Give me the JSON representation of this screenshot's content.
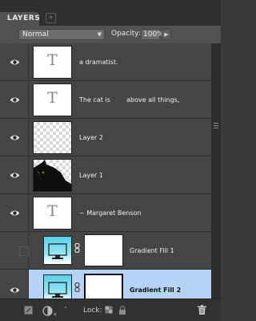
{
  "panel": {
    "tab_title": "LAYERS",
    "tab_menu_icon": "panel-menu-icon"
  },
  "controls": {
    "blend_mode": "Normal",
    "opacity_label": "Opacity:",
    "opacity_value": "100%"
  },
  "layers": [
    {
      "name": "a dramatist.",
      "thumb": "text",
      "thumb_glyph": "T",
      "visible": true,
      "selected": false
    },
    {
      "name": "The cat is        above all things,",
      "thumb": "text",
      "thumb_glyph": "T",
      "visible": true,
      "selected": false
    },
    {
      "name": "Layer 2",
      "thumb": "transparent",
      "visible": true,
      "selected": false
    },
    {
      "name": "Layer 1",
      "thumb": "cat-photo",
      "visible": true,
      "selected": false
    },
    {
      "name": "~ Margaret Benson",
      "thumb": "text",
      "thumb_glyph": "T",
      "visible": true,
      "selected": false
    },
    {
      "name": "Gradient Fill 1",
      "thumb": "gradient-fill",
      "visible": false,
      "selected": false
    },
    {
      "name": "Gradient Fill 2",
      "thumb": "gradient-fill",
      "visible": true,
      "selected": true
    }
  ],
  "footer": {
    "lock_label": "Lock:"
  },
  "colors": {
    "selection": "#b5d3f4",
    "panel_bg": "#454545",
    "gradient_top": "#5ad0ea"
  }
}
